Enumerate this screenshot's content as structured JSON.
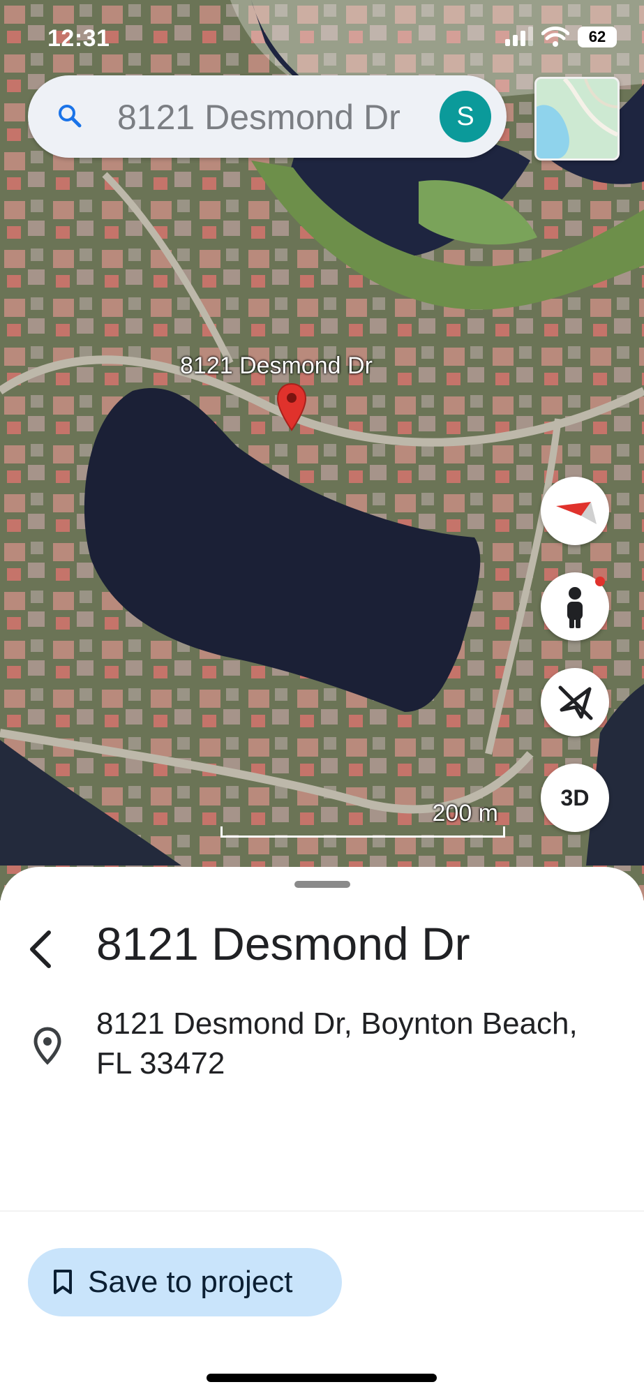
{
  "status_bar": {
    "time": "12:31",
    "battery": "62"
  },
  "search": {
    "query": "8121 Desmond Dr",
    "avatar_initial": "S",
    "icon": "search-icon"
  },
  "map": {
    "marker_label": "8121 Desmond Dr",
    "scale_label": "200 m",
    "buttons": {
      "three_d_label": "3D"
    }
  },
  "sheet": {
    "title": "8121 Desmond Dr",
    "address": "8121 Desmond Dr, Boynton Beach, FL 33472",
    "save_label": "Save to project"
  },
  "colors": {
    "accent": "#1a73e8",
    "pin": "#e0322c",
    "save_bg": "#c9e4fb",
    "avatar": "#0b9a9a"
  }
}
